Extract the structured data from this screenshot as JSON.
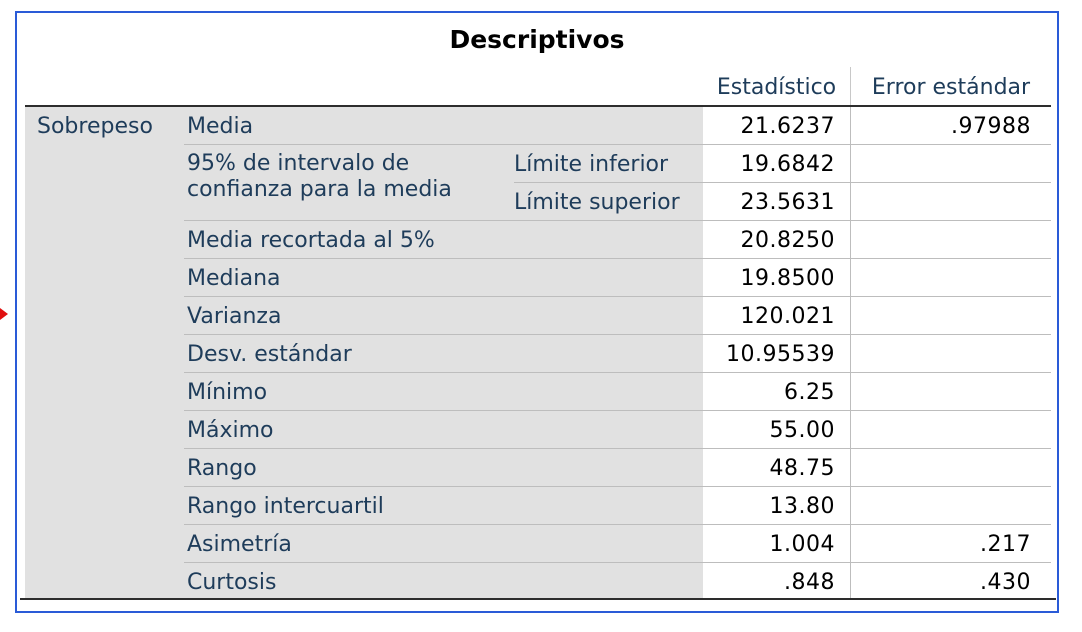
{
  "table": {
    "title": "Descriptivos",
    "headers": {
      "stat": "Estadístico",
      "error": "Error estándar"
    },
    "variable": "Sobrepeso",
    "ci_label_1": "95% de intervalo de",
    "ci_label_2": "confianza para la media",
    "rows": [
      {
        "label": "Media",
        "stat": "21.6237",
        "error": ".97988"
      },
      {
        "label": "Límite inferior",
        "stat": "19.6842",
        "error": ""
      },
      {
        "label": "Límite superior",
        "stat": "23.5631",
        "error": ""
      },
      {
        "label": "Media recortada al 5%",
        "stat": "20.8250",
        "error": ""
      },
      {
        "label": "Mediana",
        "stat": "19.8500",
        "error": ""
      },
      {
        "label": "Varianza",
        "stat": "120.021",
        "error": ""
      },
      {
        "label": "Desv. estándar",
        "stat": "10.95539",
        "error": ""
      },
      {
        "label": "Mínimo",
        "stat": "6.25",
        "error": ""
      },
      {
        "label": "Máximo",
        "stat": "55.00",
        "error": ""
      },
      {
        "label": "Rango",
        "stat": "48.75",
        "error": ""
      },
      {
        "label": "Rango intercuartil",
        "stat": "13.80",
        "error": ""
      },
      {
        "label": "Asimetría",
        "stat": "1.004",
        "error": ".217"
      },
      {
        "label": "Curtosis",
        "stat": ".848",
        "error": ".430"
      }
    ]
  },
  "colors": {
    "frame": "#2a5bd7",
    "label_text": "#1e3c5a",
    "shade": "#e1e1e1",
    "marker": "#e01010"
  }
}
